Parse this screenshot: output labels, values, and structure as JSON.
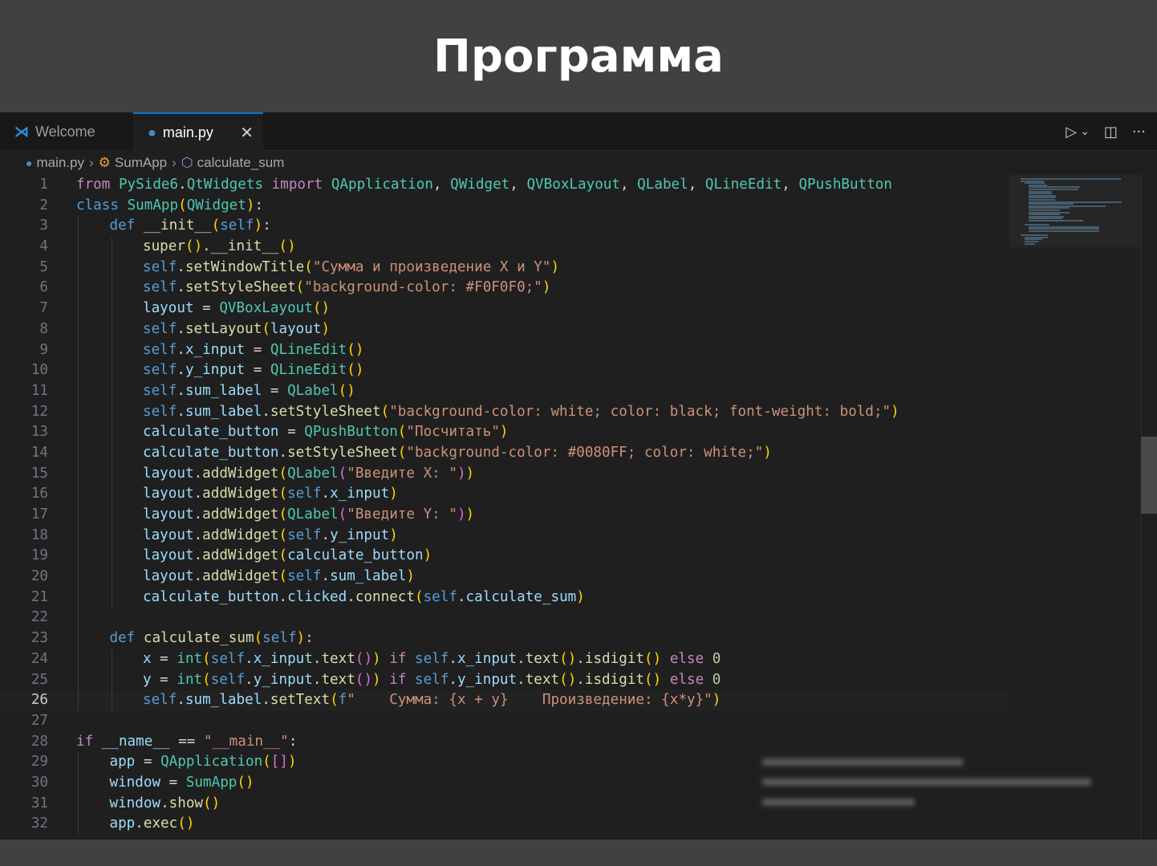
{
  "slide": {
    "title": "Программа"
  },
  "tabs": [
    {
      "label": "Welcome",
      "icon": "vscode-icon",
      "active": false
    },
    {
      "label": "main.py",
      "icon": "python-icon",
      "active": true,
      "close": "✕"
    }
  ],
  "toolbar": {
    "actions": [
      "run-icon",
      "chevron-down-icon",
      "split-editor-icon",
      "more-icon"
    ]
  },
  "breadcrumb": [
    {
      "label": "main.py",
      "icon": "python-icon"
    },
    {
      "label": "SumApp",
      "icon": "class-icon"
    },
    {
      "label": "calculate_sum",
      "icon": "method-icon"
    }
  ],
  "editor": {
    "current_line": 26,
    "lines": [
      {
        "n": "1",
        "indent": 0,
        "code": "from PySide6.QtWidgets import QApplication, QWidget, QVBoxLayout, QLabel, QLineEdit, QPushButton"
      },
      {
        "n": "2",
        "indent": 0,
        "code": "class SumApp(QWidget):"
      },
      {
        "n": "3",
        "indent": 1,
        "code": "def __init__(self):"
      },
      {
        "n": "4",
        "indent": 2,
        "code": "super().__init__()"
      },
      {
        "n": "5",
        "indent": 2,
        "code": "self.setWindowTitle(\"Сумма и произведение X и Y\")"
      },
      {
        "n": "6",
        "indent": 2,
        "code": "self.setStyleSheet(\"background-color: #F0F0F0;\")"
      },
      {
        "n": "7",
        "indent": 2,
        "code": "layout = QVBoxLayout()"
      },
      {
        "n": "8",
        "indent": 2,
        "code": "self.setLayout(layout)"
      },
      {
        "n": "9",
        "indent": 2,
        "code": "self.x_input = QLineEdit()"
      },
      {
        "n": "10",
        "indent": 2,
        "code": "self.y_input = QLineEdit()"
      },
      {
        "n": "11",
        "indent": 2,
        "code": "self.sum_label = QLabel()"
      },
      {
        "n": "12",
        "indent": 2,
        "code": "self.sum_label.setStyleSheet(\"background-color: white; color: black; font-weight: bold;\")"
      },
      {
        "n": "13",
        "indent": 2,
        "code": "calculate_button = QPushButton(\"Посчитать\")"
      },
      {
        "n": "14",
        "indent": 2,
        "code": "calculate_button.setStyleSheet(\"background-color: #0080FF; color: white;\")"
      },
      {
        "n": "15",
        "indent": 2,
        "code": "layout.addWidget(QLabel(\"Введите X: \"))"
      },
      {
        "n": "16",
        "indent": 2,
        "code": "layout.addWidget(self.x_input)"
      },
      {
        "n": "17",
        "indent": 2,
        "code": "layout.addWidget(QLabel(\"Введите Y: \"))"
      },
      {
        "n": "18",
        "indent": 2,
        "code": "layout.addWidget(self.y_input)"
      },
      {
        "n": "19",
        "indent": 2,
        "code": "layout.addWidget(calculate_button)"
      },
      {
        "n": "20",
        "indent": 2,
        "code": "layout.addWidget(self.sum_label)"
      },
      {
        "n": "21",
        "indent": 2,
        "code": "calculate_button.clicked.connect(self.calculate_sum)"
      },
      {
        "n": "22",
        "indent": 1,
        "code": ""
      },
      {
        "n": "23",
        "indent": 1,
        "code": "def calculate_sum(self):"
      },
      {
        "n": "24",
        "indent": 2,
        "code": "x = int(self.x_input.text()) if self.x_input.text().isdigit() else 0"
      },
      {
        "n": "25",
        "indent": 2,
        "code": "y = int(self.y_input.text()) if self.y_input.text().isdigit() else 0"
      },
      {
        "n": "26",
        "indent": 2,
        "code": "self.sum_label.setText(f\"    Сумма: {x + y}    Произведение: {x*y}\")"
      },
      {
        "n": "27",
        "indent": 0,
        "code": ""
      },
      {
        "n": "28",
        "indent": 0,
        "code": "if __name__ == \"__main__\":"
      },
      {
        "n": "29",
        "indent": 1,
        "code": "app = QApplication([])"
      },
      {
        "n": "30",
        "indent": 1,
        "code": "window = SumApp()"
      },
      {
        "n": "31",
        "indent": 1,
        "code": "window.show()"
      },
      {
        "n": "32",
        "indent": 1,
        "code": "app.exec()"
      }
    ]
  },
  "colors": {
    "slide_bg": "#414141",
    "editor_bg": "#1f1f1f",
    "tab_accent": "#0078d4",
    "keyword": "#c586c0",
    "storage": "#569cd6",
    "class": "#4ec9b0",
    "function": "#dcdcaa",
    "variable": "#9cdcfe",
    "string": "#ce9178",
    "number": "#b5cea8"
  }
}
